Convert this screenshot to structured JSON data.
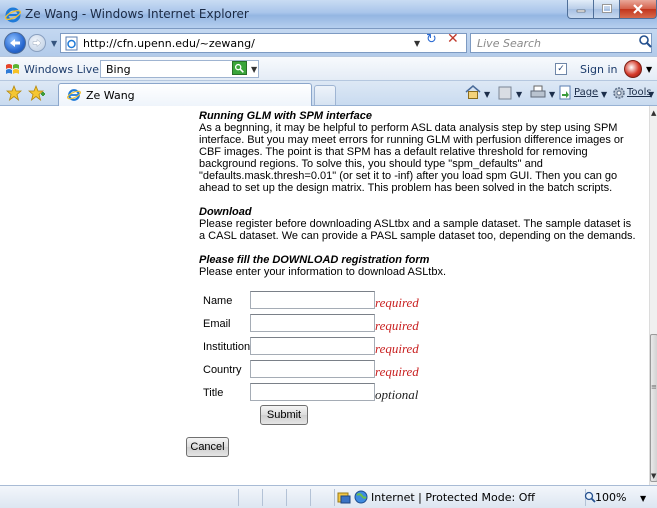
{
  "window": {
    "title": "Ze Wang - Windows Internet Explorer"
  },
  "address_bar": {
    "url": "http://cfn.upenn.edu/~zewang/",
    "search_placeholder": "Live Search"
  },
  "live_toolbar": {
    "label": "Windows Live",
    "search_value": "Bing",
    "sign_in": "Sign in"
  },
  "tabs": {
    "active_title": "Ze Wang"
  },
  "command_bar": {
    "page_label": "Page",
    "tools_label": "Tools"
  },
  "content": {
    "glm_heading": "Running GLM with SPM interface",
    "glm_text": "As a begnning, it may be helpful to perform ASL data analysis step by step using SPM interface. But you may meet errors for running GLM with perfusion difference images or CBF images. The point is that SPM has a default relative threshold for removing background regions. To solve this, you should type \"spm_defaults\" and \"defaults.mask.thresh=0.01\" (or set it to -inf) after you load spm GUI. Then you can go ahead to set up the design matrix. This problem has been solved in the batch scripts.",
    "download_heading": "Download",
    "download_text": "Please register before downloading ASLtbx and a sample dataset. The sample dataset is a CASL dataset. We can provide a PASL sample dataset too, depending on the demands.",
    "form_heading": "Please fill the DOWNLOAD registration form",
    "form_intro": "Please enter your information to download ASLtbx."
  },
  "form": {
    "fields": [
      {
        "label": "Name",
        "note": "required",
        "value": ""
      },
      {
        "label": "Email",
        "note": "required",
        "value": ""
      },
      {
        "label": "Institution",
        "note": "required",
        "value": ""
      },
      {
        "label": "Country",
        "note": "required",
        "value": ""
      },
      {
        "label": "Title",
        "note": "optional",
        "value": ""
      }
    ],
    "submit_label": "Submit",
    "cancel_label": "Cancel"
  },
  "status_bar": {
    "zone": "Internet | Protected Mode: Off",
    "zoom": "100%"
  },
  "colors": {
    "required_note": "#c81f1f",
    "titlebar": "#a9c5ea",
    "close_button": "#c2351c"
  }
}
